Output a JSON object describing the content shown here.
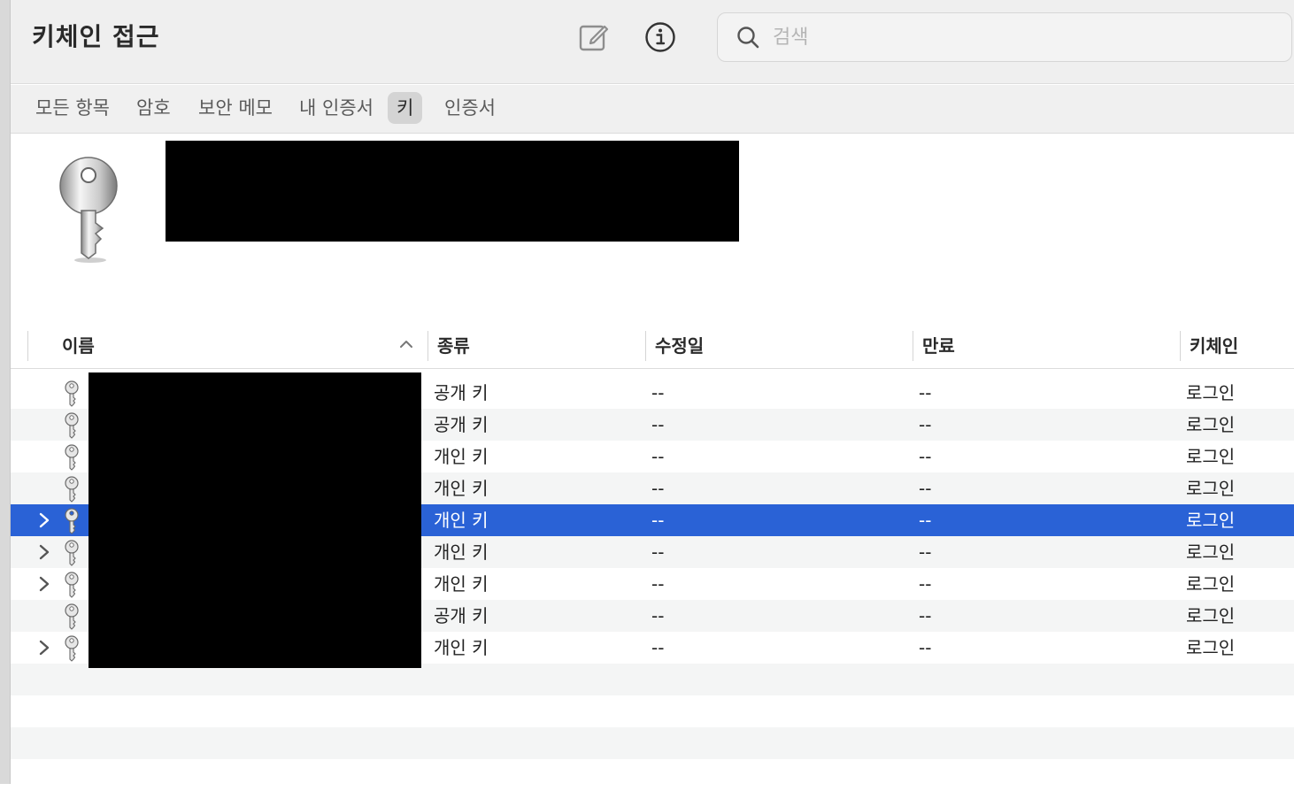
{
  "app": {
    "title": "키체인 접근"
  },
  "toolbar": {
    "edit_icon": "square-and-pencil",
    "info_icon": "info-circle",
    "search_placeholder": "검색",
    "search_value": ""
  },
  "tabs": [
    {
      "label": "모든 항목",
      "active": false
    },
    {
      "label": "암호",
      "active": false
    },
    {
      "label": "보안 메모",
      "active": false
    },
    {
      "label": "내 인증서",
      "active": false
    },
    {
      "label": "키",
      "active": true
    },
    {
      "label": "인증서",
      "active": false
    }
  ],
  "detail": {
    "icon": "key-icon"
  },
  "table": {
    "columns": [
      "이름",
      "종류",
      "수정일",
      "만료",
      "키체인"
    ],
    "sort_column": "이름",
    "sort_direction": "ascending",
    "rows": [
      {
        "kind": "공개 키",
        "modified": "--",
        "expires": "--",
        "keychain": "로그인",
        "expandable": false,
        "selected": false
      },
      {
        "kind": "공개 키",
        "modified": "--",
        "expires": "--",
        "keychain": "로그인",
        "expandable": false,
        "selected": false
      },
      {
        "kind": "개인 키",
        "modified": "--",
        "expires": "--",
        "keychain": "로그인",
        "expandable": false,
        "selected": false
      },
      {
        "kind": "개인 키",
        "modified": "--",
        "expires": "--",
        "keychain": "로그인",
        "expandable": false,
        "selected": false
      },
      {
        "kind": "개인 키",
        "modified": "--",
        "expires": "--",
        "keychain": "로그인",
        "expandable": true,
        "selected": true
      },
      {
        "kind": "개인 키",
        "modified": "--",
        "expires": "--",
        "keychain": "로그인",
        "expandable": true,
        "selected": false
      },
      {
        "kind": "개인 키",
        "modified": "--",
        "expires": "--",
        "keychain": "로그인",
        "expandable": true,
        "selected": false
      },
      {
        "kind": "공개 키",
        "modified": "--",
        "expires": "--",
        "keychain": "로그인",
        "expandable": false,
        "selected": false
      },
      {
        "kind": "개인 키",
        "modified": "--",
        "expires": "--",
        "keychain": "로그인",
        "expandable": true,
        "selected": false
      }
    ]
  },
  "colors": {
    "selection": "#2a62d6",
    "toolbar_bg": "#efefef",
    "alt_row": "#f4f5f5"
  }
}
